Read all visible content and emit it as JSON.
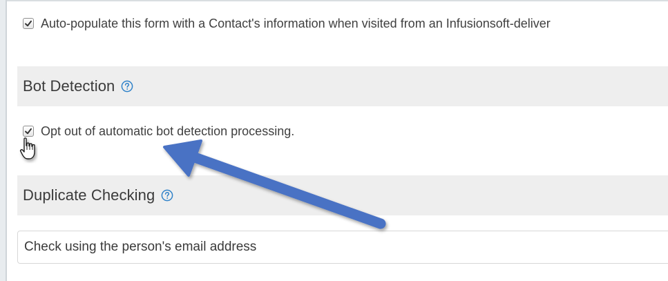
{
  "auto_populate": {
    "label": "Auto-populate this form with a Contact's information when visited from an Infusionsoft-deliver",
    "checked": true
  },
  "bot_detection": {
    "heading": "Bot Detection",
    "help_icon": "question-circle-icon",
    "opt_out_label": "Opt out of automatic bot detection processing.",
    "checked": true
  },
  "duplicate_checking": {
    "heading": "Duplicate Checking",
    "help_icon": "question-circle-icon",
    "selected_option": "Check using the person's email address"
  },
  "annotation": {
    "arrow_color": "#4a72c4",
    "cursor": "hand-pointer-icon"
  }
}
